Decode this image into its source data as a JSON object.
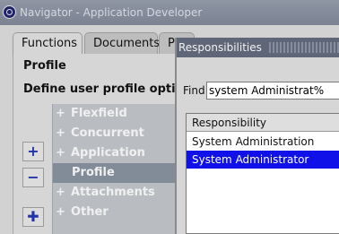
{
  "window": {
    "title": "Navigator - Application Developer"
  },
  "tabs": [
    {
      "label": "Functions",
      "active": true
    },
    {
      "label": "Documents",
      "active": false
    },
    {
      "label": "P",
      "active": false
    }
  ],
  "main": {
    "function_name": "Profile",
    "function_description": "Define user profile option"
  },
  "tree": {
    "items": [
      {
        "label": "Flexfield",
        "expand": "+"
      },
      {
        "label": "Concurrent",
        "expand": "+"
      },
      {
        "label": "Application",
        "expand": "+"
      },
      {
        "label": "Profile",
        "expand": "",
        "selected": true
      },
      {
        "label": "Attachments",
        "expand": "+"
      },
      {
        "label": "Other",
        "expand": "+"
      }
    ]
  },
  "side_buttons": [
    {
      "icon": "plus-icon",
      "glyph": "+"
    },
    {
      "icon": "minus-icon",
      "glyph": "−"
    },
    {
      "icon": "expand-branch-icon",
      "glyph": "✚"
    }
  ],
  "responsibilities": {
    "title": "Responsibilities",
    "find_label": "Find",
    "find_value": "system Administrat%",
    "column_header": "Responsibility",
    "rows": [
      {
        "label": "System Administration",
        "selected": false
      },
      {
        "label": "System Administrator",
        "selected": true
      }
    ]
  },
  "colors": {
    "selection": "#1010e8",
    "titlebar": "#7b8291",
    "tree_bg": "#b9bdc2",
    "tree_selected": "#828c99"
  }
}
